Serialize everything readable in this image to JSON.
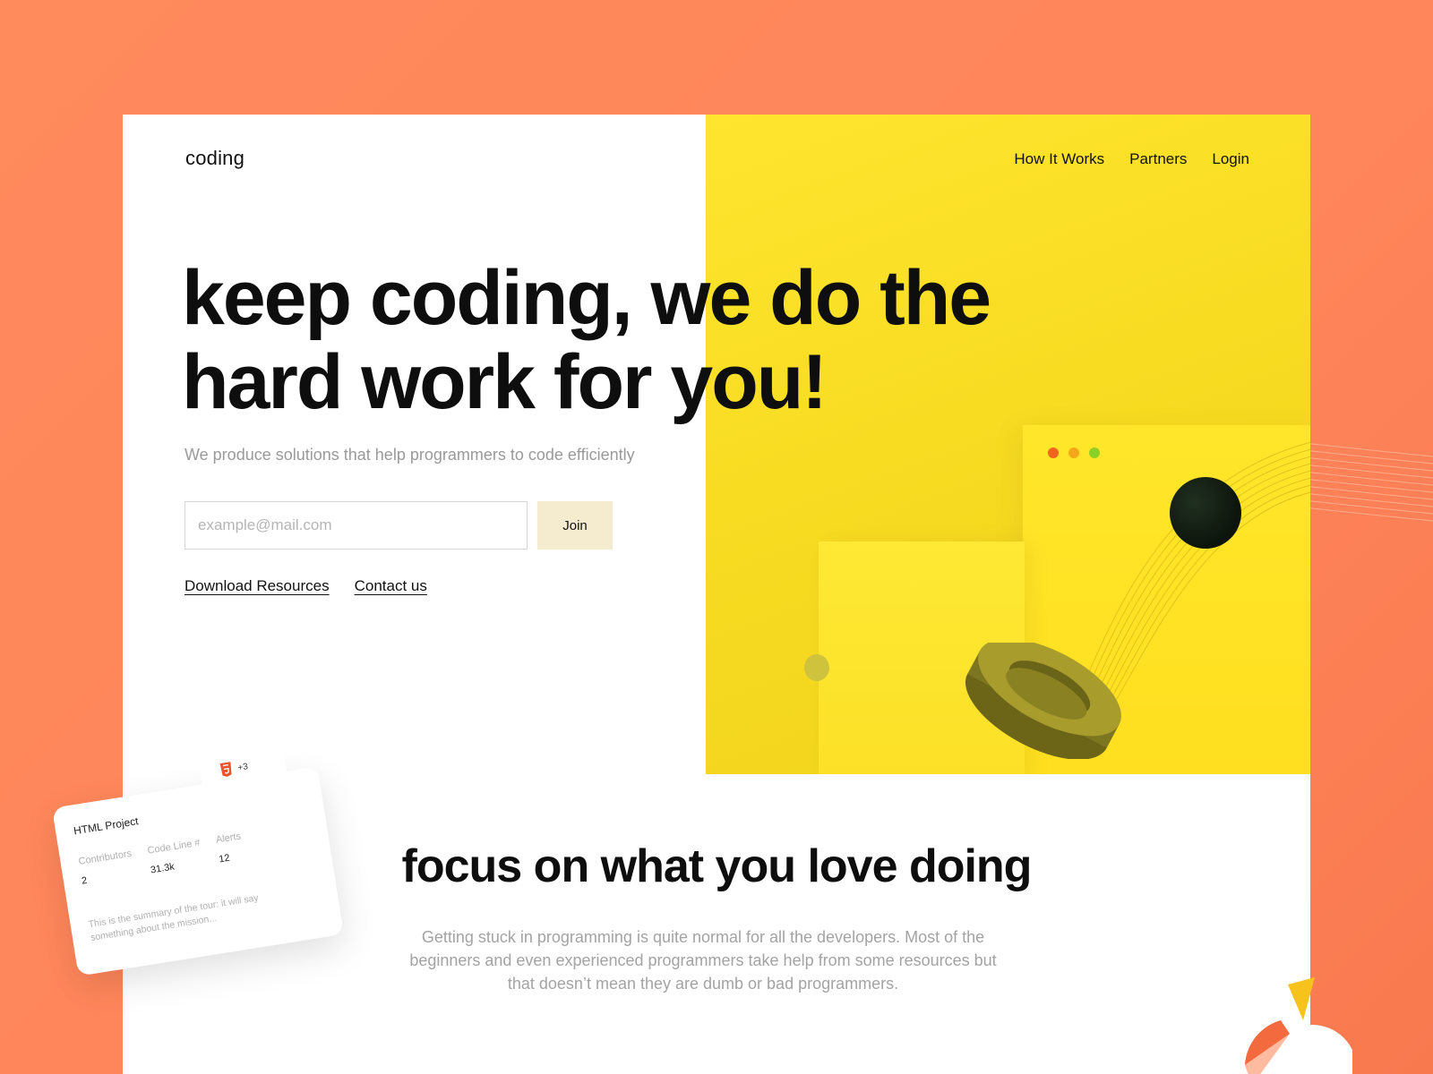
{
  "brand": {
    "logo_text": "coding"
  },
  "nav": {
    "items": [
      "How It Works",
      "Partners",
      "Login"
    ]
  },
  "hero": {
    "headline_line1": "keep coding, we do the",
    "headline_line2": "hard work for you!",
    "subtitle": "We produce solutions that help programmers to code efficiently",
    "email_placeholder": "example@mail.com",
    "join_label": "Join",
    "links": [
      "Download Resources",
      "Contact us"
    ]
  },
  "art": {
    "window_dots": [
      "#f0621e",
      "#f5a61b",
      "#8ad026"
    ]
  },
  "section": {
    "title": "focus on what you love doing",
    "body": "Getting stuck in programming is quite normal for all the developers. Most of the beginners and even experienced programmers take help from some resources but that doesn’t mean they are dumb or bad programmers."
  },
  "card": {
    "title": "HTML Project",
    "badge_icon": "html5-icon",
    "badge_count": "+3",
    "stats": [
      {
        "label": "Contributors",
        "value": "2"
      },
      {
        "label": "Code Line #",
        "value": "31.3k"
      },
      {
        "label": "Alerts",
        "value": "12"
      }
    ],
    "summary": "This is the summary of the tour: it will say something about the mission..."
  },
  "colors": {
    "background": "#ff8a5c",
    "accent_yellow": "#ffe52e",
    "join_button": "#f5ecd0",
    "text_dark": "#0e0e0e",
    "text_muted": "#9a9a9a"
  }
}
